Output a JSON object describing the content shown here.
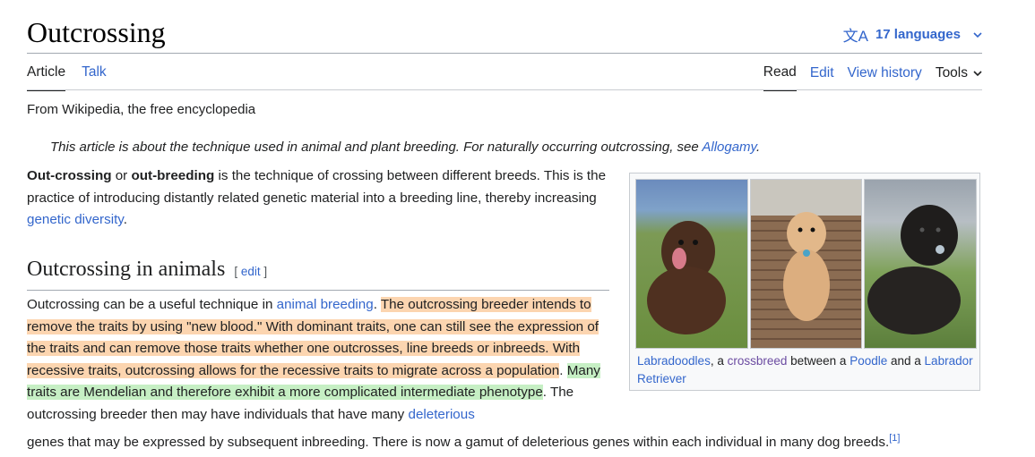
{
  "header": {
    "title": "Outcrossing",
    "languages_label": "17 languages",
    "language_icon_glyph": "文A"
  },
  "tabs": {
    "left": [
      {
        "label": "Article",
        "selected": true
      },
      {
        "label": "Talk",
        "selected": false
      }
    ],
    "right": [
      {
        "label": "Read",
        "selected": true
      },
      {
        "label": "Edit",
        "selected": false
      },
      {
        "label": "View history",
        "selected": false
      },
      {
        "label": "Tools",
        "selected": false
      }
    ]
  },
  "tagline": "From Wikipedia, the free encyclopedia",
  "hatnote": {
    "text": "This article is about the technique used in animal and plant breeding. For naturally occurring outcrossing, see ",
    "link": "Allogamy",
    "end": "."
  },
  "intro": {
    "b1": "Out-crossing",
    "t1": " or ",
    "b2": "out-breeding",
    "t2": " is the technique of crossing between different breeds. This is the practice of introducing distantly related genetic material into a breeding line, thereby increasing ",
    "link": "genetic diversity",
    "t3": "."
  },
  "section": {
    "heading": "Outcrossing in animals",
    "edit_open": "[ ",
    "edit_label": "edit",
    "edit_close": " ]"
  },
  "animals": {
    "t1": "Outcrossing can be a useful technique in ",
    "link1": "animal breeding",
    "t2": ". ",
    "orange": "The outcrossing breeder intends to remove the traits by using \"new blood.\" With dominant traits, one can still see the expression of the traits and can remove those traits whether one outcrosses, line breeds or inbreeds. With recessive traits, outcrossing allows for the recessive traits to migrate across a population",
    "t3": ". ",
    "green": "Many traits are Mendelian and therefore exhibit a more complicated intermediate phenotype",
    "t4": ". The outcrossing breeder then may have individuals that have many ",
    "link2": "deleterious",
    "last_line": "genes that may be expressed by subsequent inbreeding. There is now a gamut of deleterious genes within each individual in many dog breeds.",
    "ref": "[1]"
  },
  "infobox": {
    "caption": {
      "link1": "Labradoodles",
      "t1": ", a ",
      "link2": "crossbreed",
      "t2": " between a ",
      "link3": "Poodle",
      "t3": " and a ",
      "link4": "Labrador Retriever"
    }
  },
  "colors": {
    "link": "#3366cc",
    "visited_link": "#6b4ba1",
    "highlight_orange": "#fcd5b0",
    "highlight_green": "#c6efc4"
  }
}
